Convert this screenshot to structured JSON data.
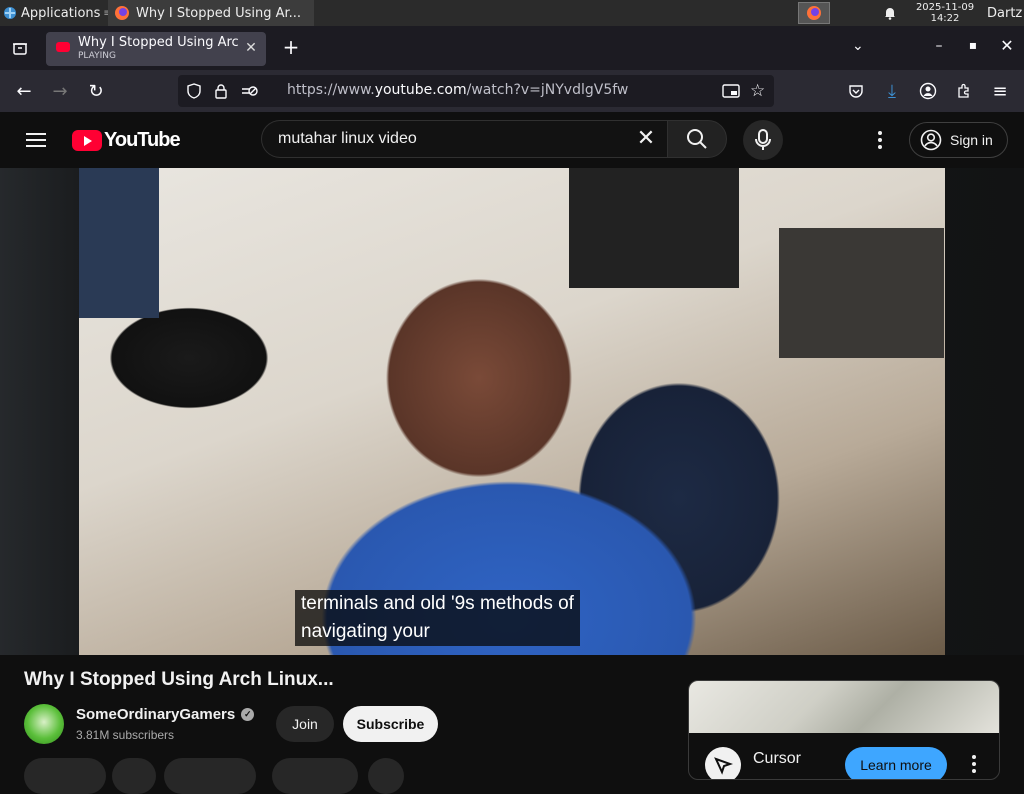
{
  "taskbar": {
    "apps_label": "Applications",
    "window_title": "Why I Stopped Using Ar...",
    "clock_date": "2025-11-09",
    "clock_time": "14:22",
    "user": "Dartz"
  },
  "browser": {
    "tab_title": "Why I Stopped Using Arch",
    "tab_status": "PLAYING",
    "url_prefix": "https://www.",
    "url_domain": "youtube.com",
    "url_path": "/watch?v=jNYvdlgV5fw"
  },
  "youtube": {
    "logo_text": "YouTube",
    "search_value": "mutahar linux video",
    "sign_in": "Sign in"
  },
  "video": {
    "caption_line1": "terminals and old '9s methods of",
    "caption_line2": "navigating your",
    "title": "Why I Stopped Using Arch Linux...",
    "channel_name": "SomeOrdinaryGamers",
    "subscribers": "3.81M subscribers",
    "join_label": "Join",
    "subscribe_label": "Subscribe"
  },
  "ad": {
    "name": "Cursor",
    "cta": "Learn more"
  },
  "colors": {
    "youtube_red": "#ff0033",
    "background": "#0f0f0f",
    "cta_blue": "#3ea6ff"
  }
}
